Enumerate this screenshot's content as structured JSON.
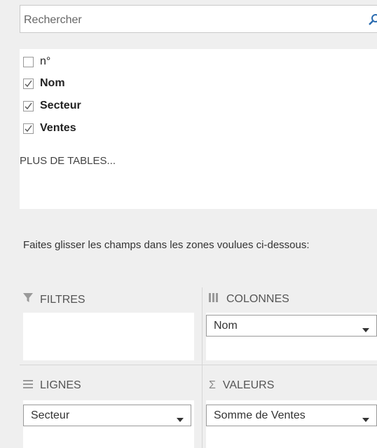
{
  "search": {
    "placeholder": "Rechercher",
    "icon": "search-icon"
  },
  "fields": [
    {
      "label": "n°",
      "checked": false
    },
    {
      "label": "Nom",
      "checked": true
    },
    {
      "label": "Secteur",
      "checked": true
    },
    {
      "label": "Ventes",
      "checked": true
    }
  ],
  "more_tables": "PLUS DE TABLES...",
  "instruction": "Faites glisser les champs dans les zones voulues ci-dessous:",
  "areas": {
    "filters": {
      "title": "FILTRES",
      "icon": "filter-icon"
    },
    "columns": {
      "title": "COLONNES",
      "icon": "columns-icon",
      "item": "Nom"
    },
    "rows": {
      "title": "LIGNES",
      "icon": "rows-icon",
      "item": "Secteur"
    },
    "values": {
      "title": "VALEURS",
      "icon": "sigma-icon",
      "item": "Somme de Ventes"
    }
  },
  "colors": {
    "accent": "#2b6cb0",
    "background": "#efefef"
  }
}
